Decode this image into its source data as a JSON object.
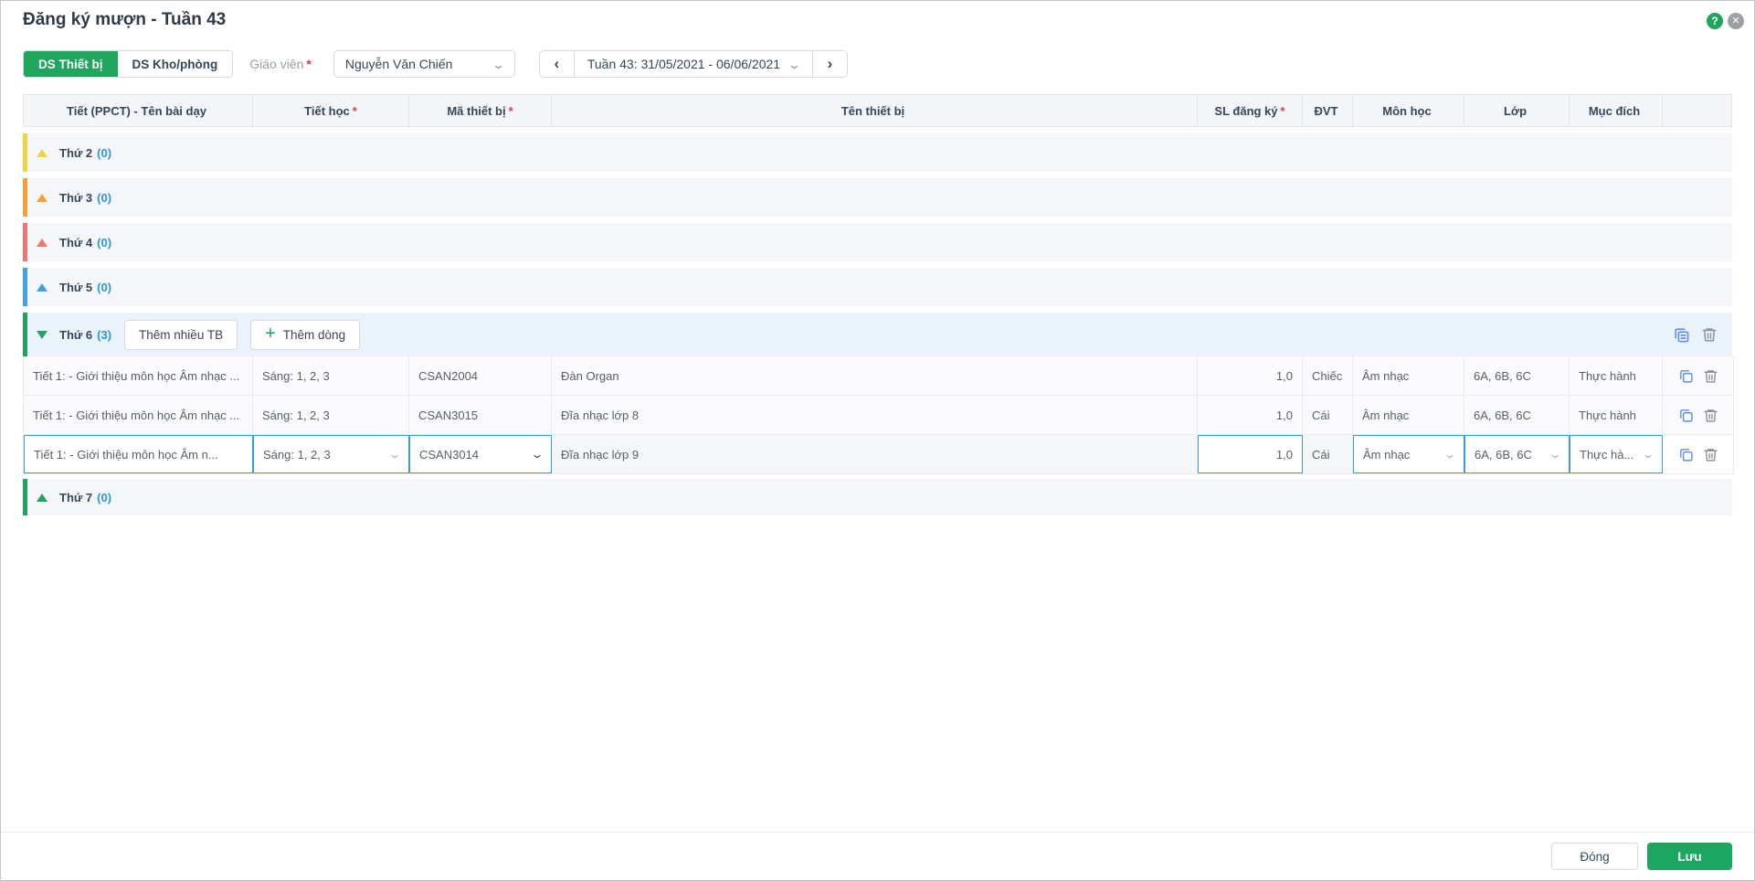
{
  "modal": {
    "title": "Đăng ký mượn - Tuần 43"
  },
  "icons": {
    "help": "?",
    "close": "✕",
    "prev": "‹",
    "next": "›",
    "chevron_down": "⌄",
    "plus": "+"
  },
  "toolbar": {
    "tabs": [
      {
        "label": "DS Thiết bị"
      },
      {
        "label": "DS Kho/phòng"
      }
    ],
    "teacher_label": "Giáo viên",
    "required_star": "*",
    "teacher_value": "Nguyễn Văn Chiến",
    "week_label": "Tuần 43: 31/05/2021 - 06/06/2021"
  },
  "colors": {
    "accent_green": "#21a45d",
    "count_blue": "#2a95e5",
    "edit_border_blue": "#3d9bd8"
  },
  "table": {
    "columns": [
      {
        "label": "Tiết (PPCT) - Tên bài dạy",
        "star": ""
      },
      {
        "label": "Tiết học",
        "star": "*"
      },
      {
        "label": "Mã thiết bị",
        "star": "*"
      },
      {
        "label": "Tên thiết bị",
        "star": ""
      },
      {
        "label": "SL đăng ký",
        "star": "*"
      },
      {
        "label": "ĐVT",
        "star": ""
      },
      {
        "label": "Môn học",
        "star": ""
      },
      {
        "label": "Lớp",
        "star": ""
      },
      {
        "label": "Mục đích",
        "star": ""
      }
    ],
    "days": [
      {
        "label": "Thứ 2",
        "count": "(0)",
        "color": "#f2d33c"
      },
      {
        "label": "Thứ 3",
        "count": "(0)",
        "color": "#f5a033"
      },
      {
        "label": "Thứ 4",
        "count": "(0)",
        "color": "#f3736f"
      },
      {
        "label": "Thứ 5",
        "count": "(0)",
        "color": "#41a0e8"
      },
      {
        "label": "Thứ 6",
        "count": "(3)",
        "color": "#21a461"
      },
      {
        "label": "Thứ 7",
        "count": "(0)",
        "color": "#21a461"
      }
    ],
    "day6_buttons": {
      "add_many": "Thêm nhiều TB",
      "add_row": "Thêm dòng"
    },
    "rows": [
      {
        "lesson": "Tiết 1: - Giới thiệu môn học Âm nhạc ...",
        "period": "Sáng: 1, 2, 3",
        "code": "CSAN2004",
        "name": "Đàn Organ",
        "qty": "1,0",
        "unit": "Chiếc",
        "subject": "Âm nhạc",
        "classes": "6A, 6B, 6C",
        "purpose": "Thực hành"
      },
      {
        "lesson": "Tiết 1: - Giới thiệu môn học Âm nhạc ...",
        "period": "Sáng: 1, 2, 3",
        "code": "CSAN3015",
        "name": "Đĩa nhạc lớp 8",
        "qty": "1,0",
        "unit": "Cái",
        "subject": "Âm nhạc",
        "classes": "6A, 6B, 6C",
        "purpose": "Thực hành"
      },
      {
        "lesson": "Tiết 1: - Giới thiệu môn học Âm n...",
        "period": "Sáng: 1, 2, 3",
        "code": "CSAN3014",
        "name": "Đĩa nhạc lớp 9",
        "qty": "1,0",
        "unit": "Cái",
        "subject": "Âm nhạc",
        "classes": "6A, 6B, 6C",
        "purpose": "Thực hà..."
      }
    ]
  },
  "footer": {
    "close_label": "Đóng",
    "save_label": "Lưu"
  }
}
